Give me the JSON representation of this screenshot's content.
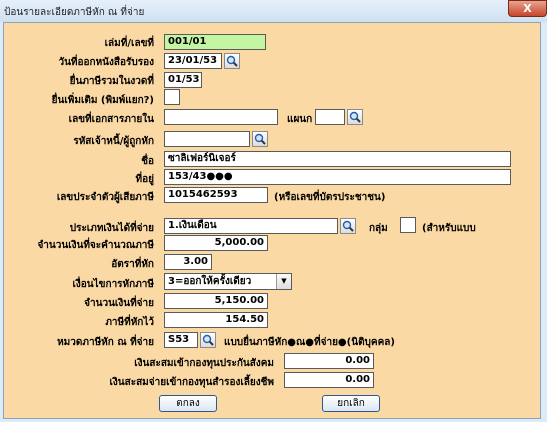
{
  "window": {
    "title": "ป้อนรายละเอียดภาษีหัก ณ ที่จ่าย",
    "close_label": "X"
  },
  "form": {
    "book_no_label": "เล่มที่/เลขที่",
    "book_no_value": "001/01",
    "issue_date_label": "วันที่ออกหนังสือรับรอง",
    "issue_date_value": "23/01/53",
    "tax_period_label": "ยื่นภาษีรวมในงวดที่",
    "tax_period_value": "01/53",
    "additional_label": "ยื่นเพิ่มเติม (พิมพ์แยก?)",
    "internal_doc_label": "เลขที่เอกสารภายใน",
    "internal_doc_value": "",
    "department_label": "แผนก",
    "department_value": "",
    "creditor_code_label": "รหัสเจ้าหนี้/ผู้ถูกหัก",
    "creditor_code_value": "",
    "name_label": "ชื่อ",
    "name_value": "ซาลิเฟอร์นิเจอร์",
    "address_label": "ที่อยู่",
    "address_value": "153/43●●●",
    "tax_id_label": "เลขประจำตัวผู้เสียภาษี",
    "tax_id_value": "1015462593",
    "tax_id_note": "(หรือเลขที่บัตรประชาชน)",
    "income_type_label": "ประเภทเงินได้ที่จ่าย",
    "income_type_value": "1.เงินเดือน",
    "group_label": "กลุ่ม",
    "group_value": "",
    "group_note": "(สำหรับแบบ",
    "calc_amount_label": "จำนวนเงินที่จะคำนวณภาษี",
    "calc_amount_value": "5,000.00",
    "rate_label": "อัตราที่หัก",
    "rate_value": "3.00",
    "condition_label": "เงื่อนไขการหักภาษี",
    "condition_value": "3=ออกให้ครั้งเดียว",
    "paid_amount_label": "จำนวนเงินที่จ่าย",
    "paid_amount_value": "5,150.00",
    "tax_withheld_label": "ภาษีที่หักไว้",
    "tax_withheld_value": "154.50",
    "wht_category_label": "หมวดภาษีหัก ณ ที่จ่าย",
    "wht_category_value": "S53",
    "wht_category_note": "แบบยื่นภาษีหัก●ณ●ที่จ่าย●(นิติบุคคล)",
    "social_fund_label": "เงินสะสมเข้ากองทุนประกันสังคม",
    "social_fund_value": "0.00",
    "provident_fund_label": "เงินสะสมจ่ายเข้ากองทุนสำรองเลี้ยงชีพ",
    "provident_fund_value": "0.00"
  },
  "buttons": {
    "ok_label": "ตกลง",
    "cancel_label": "ยกเลิก"
  }
}
